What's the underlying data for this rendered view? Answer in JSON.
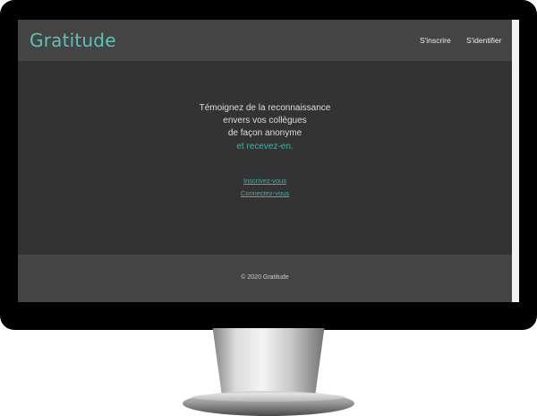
{
  "header": {
    "brand": "Gratitude",
    "nav": {
      "signup": "S'inscrire",
      "login": "S'identifier"
    }
  },
  "hero": {
    "lines": [
      "Témoignez de la reconnaissance",
      "envers vos collègues",
      "de façon anonyme",
      "et recevez-en."
    ],
    "links": {
      "signup": "Inscrivez-vous",
      "login": "Connectez-vous"
    }
  },
  "footer": {
    "copyright": "© 2020 Gratitude"
  },
  "colors": {
    "accent": "#3fb3a8",
    "brand": "#5ec2b6",
    "header_bg": "#444444",
    "body_bg": "#333333",
    "footer_bg": "#444444",
    "monitor_bezel": "#000000"
  }
}
